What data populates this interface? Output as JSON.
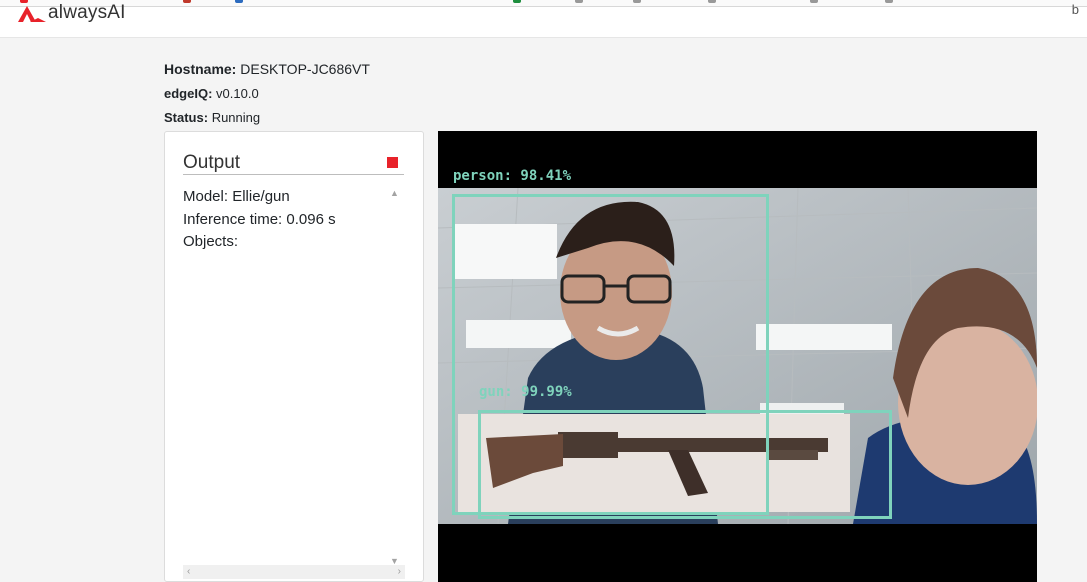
{
  "app": {
    "logo_text": "alwaysAI",
    "corner_letter": "b",
    "brand_color": "#e8222a"
  },
  "info": {
    "hostname_label": "Hostname:",
    "hostname_value": "DESKTOP-JC686VT",
    "edgeiq_label": "edgeIQ:",
    "edgeiq_value": "v0.10.0",
    "status_label": "Status:",
    "status_value": "Running"
  },
  "output": {
    "title": "Output",
    "stop_icon": "stop-square-icon",
    "lines": [
      "Model: Ellie/gun",
      "Inference time: 0.096 s",
      "Objects:"
    ]
  },
  "video": {
    "detections": [
      {
        "label": "person: 98.41%"
      },
      {
        "label": "gun: 99.99%"
      }
    ],
    "box_color": "#7fd3bc"
  }
}
